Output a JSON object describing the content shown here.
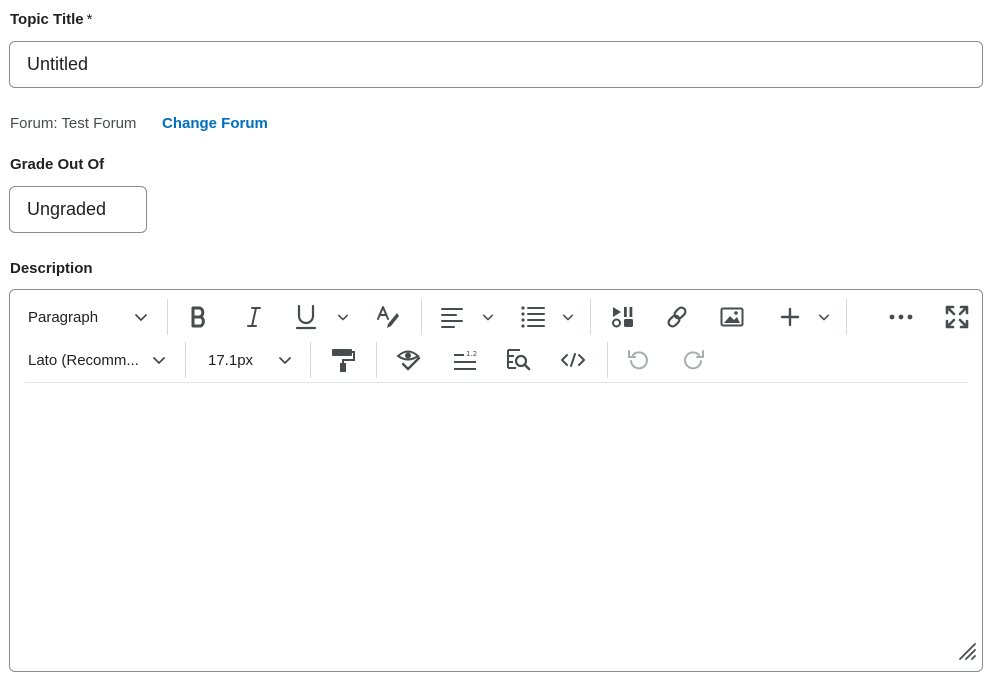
{
  "topic_title": {
    "label": "Topic Title",
    "required_mark": "*",
    "value": "Untitled"
  },
  "forum": {
    "text": "Forum: Test Forum",
    "change_link": "Change Forum"
  },
  "grade": {
    "label": "Grade Out Of",
    "value": "Ungraded"
  },
  "description": {
    "label": "Description"
  },
  "toolbar": {
    "block_format": "Paragraph",
    "font_family": "Lato (Recomm...",
    "font_size": "17.1px",
    "icons": {
      "bold": "bold-icon",
      "italic": "italic-icon",
      "underline": "underline-icon",
      "format_painter_text": "text-style-icon",
      "align": "align-icon",
      "list": "bulleted-list-icon",
      "media": "insert-media-icon",
      "link": "link-icon",
      "image": "image-icon",
      "insert": "plus-icon",
      "more": "more-icon",
      "fullscreen": "fullscreen-icon",
      "format_painter": "paint-roller-icon",
      "accessibility": "accessibility-check-icon",
      "word_count": "word-count-icon",
      "find_replace": "find-replace-icon",
      "source_code": "source-code-icon",
      "undo": "undo-icon",
      "redo": "redo-icon"
    }
  },
  "colors": {
    "link": "#006fbf",
    "border": "#868c8f",
    "icon": "#494c4e",
    "disabled_icon": "#a9acae"
  }
}
